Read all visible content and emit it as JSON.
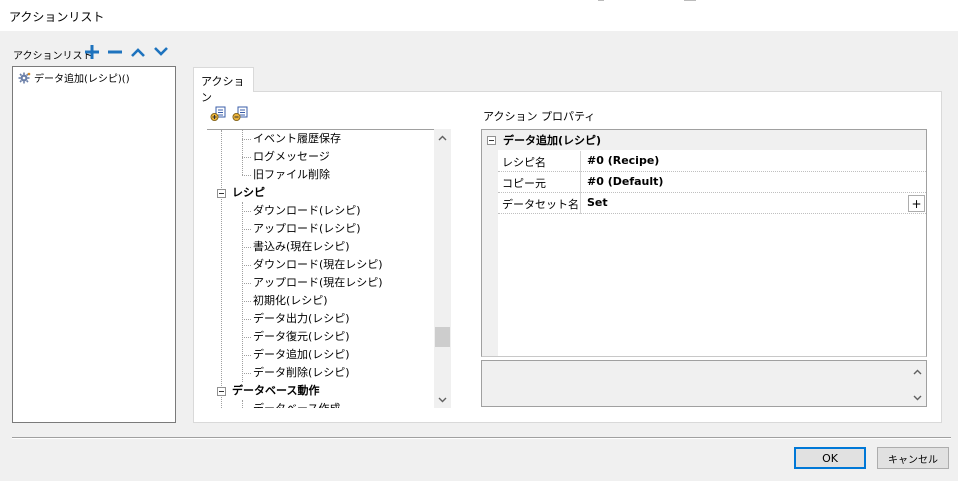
{
  "window": {
    "title": "アクションリスト"
  },
  "action_list": {
    "label": "アクションリスト",
    "items": [
      {
        "label": "データ追加(レシピ)()",
        "icon": "gear-icon"
      }
    ]
  },
  "toolbar": {
    "add": "plus-icon",
    "remove": "minus-icon",
    "move_up": "chevron-up-icon",
    "move_down": "chevron-down-icon"
  },
  "tabs": [
    {
      "label": "アクション"
    }
  ],
  "tree": {
    "items": [
      {
        "label": "イベント履歴保存",
        "type": "leaf"
      },
      {
        "label": "ログメッセージ",
        "type": "leaf"
      },
      {
        "label": "旧ファイル削除",
        "type": "leaf"
      },
      {
        "label": "レシピ",
        "type": "group"
      },
      {
        "label": "ダウンロード(レシピ)",
        "type": "leaf"
      },
      {
        "label": "アップロード(レシピ)",
        "type": "leaf"
      },
      {
        "label": "書込み(現在レシピ)",
        "type": "leaf"
      },
      {
        "label": "ダウンロード(現在レシピ)",
        "type": "leaf"
      },
      {
        "label": "アップロード(現在レシピ)",
        "type": "leaf"
      },
      {
        "label": "初期化(レシピ)",
        "type": "leaf"
      },
      {
        "label": "データ出力(レシピ)",
        "type": "leaf"
      },
      {
        "label": "データ復元(レシピ)",
        "type": "leaf"
      },
      {
        "label": "データ追加(レシピ)",
        "type": "leaf",
        "selected": true
      },
      {
        "label": "データ削除(レシピ)",
        "type": "leaf"
      },
      {
        "label": "データベース動作",
        "type": "group"
      },
      {
        "label": "データベース作成",
        "type": "leaf"
      }
    ]
  },
  "properties": {
    "label": "アクション プロパティ",
    "category": "データ追加(レシピ)",
    "rows": [
      {
        "name": "レシピ名",
        "value": "#0 (Recipe)"
      },
      {
        "name": "コピー元",
        "value": "#0 (Default)"
      },
      {
        "name": "データセット名",
        "value": "Set",
        "button": "+"
      }
    ]
  },
  "buttons": {
    "ok": "OK",
    "cancel": "キャンセル"
  },
  "colors": {
    "accent": "#0078d7",
    "toolbar_icon": "#1e73be"
  }
}
